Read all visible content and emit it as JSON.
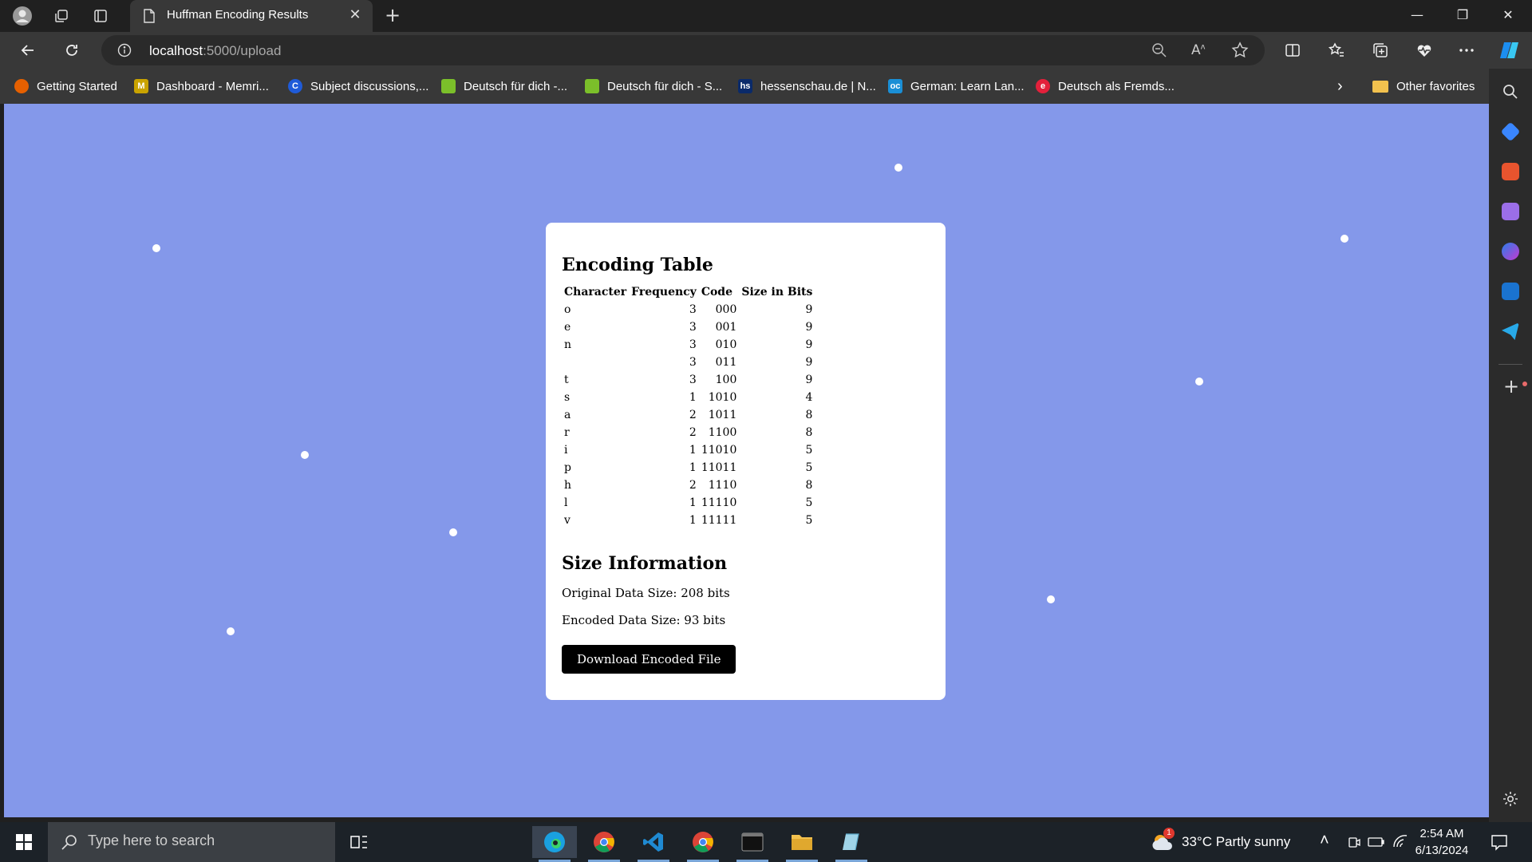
{
  "browser": {
    "tab_title": "Huffman Encoding Results",
    "tab_close": "✕",
    "new_tab": "+",
    "url_host": "localhost",
    "url_path": ":5000/upload",
    "window_controls": {
      "minimize": "—",
      "restore": "❐",
      "close": "✕"
    }
  },
  "favorites": [
    {
      "label": "Getting Started",
      "color": "#e66000",
      "glyph": ""
    },
    {
      "label": "Dashboard - Memri...",
      "color": "#c9a300",
      "glyph": "M"
    },
    {
      "label": "Subject discussions,...",
      "color": "#1f5bd8",
      "glyph": "C"
    },
    {
      "label": "Deutsch für dich -...",
      "color": "#7bbf2a",
      "glyph": ""
    },
    {
      "label": "Deutsch für dich - S...",
      "color": "#7bbf2a",
      "glyph": ""
    },
    {
      "label": "hessenschau.de | N...",
      "color": "#0a2a6a",
      "glyph": "hs"
    },
    {
      "label": "German: Learn Lan...",
      "color": "#1a8fd6",
      "glyph": "oc"
    },
    {
      "label": "Deutsch als Fremds...",
      "color": "#e3203b",
      "glyph": "e"
    }
  ],
  "other_favorites": "Other favorites",
  "main": {
    "table_heading": "Encoding Table",
    "columns": [
      "Character",
      "Frequency",
      "Code",
      "Size in Bits"
    ],
    "rows": [
      [
        "o",
        "3",
        "000",
        "9"
      ],
      [
        "e",
        "3",
        "001",
        "9"
      ],
      [
        "n",
        "3",
        "010",
        "9"
      ],
      [
        " ",
        "3",
        "011",
        "9"
      ],
      [
        "t",
        "3",
        "100",
        "9"
      ],
      [
        "s",
        "1",
        "1010",
        "4"
      ],
      [
        "a",
        "2",
        "1011",
        "8"
      ],
      [
        "r",
        "2",
        "1100",
        "8"
      ],
      [
        "i",
        "1",
        "11010",
        "5"
      ],
      [
        "p",
        "1",
        "11011",
        "5"
      ],
      [
        "h",
        "2",
        "1110",
        "8"
      ],
      [
        "l",
        "1",
        "11110",
        "5"
      ],
      [
        "v",
        "1",
        "11111",
        "5"
      ]
    ],
    "size_heading": "Size Information",
    "original_size": "Original Data Size: 208 bits",
    "encoded_size": "Encoded Data Size: 93 bits",
    "download_label": "Download Encoded File"
  },
  "taskbar": {
    "search_placeholder": "Type here to search",
    "weather": "33°C  Partly sunny",
    "weather_badge": "1",
    "time": "2:54 AM",
    "date": "6/13/2024"
  },
  "colors": {
    "page_bg": "#8498ea",
    "button_bg": "#000000"
  }
}
